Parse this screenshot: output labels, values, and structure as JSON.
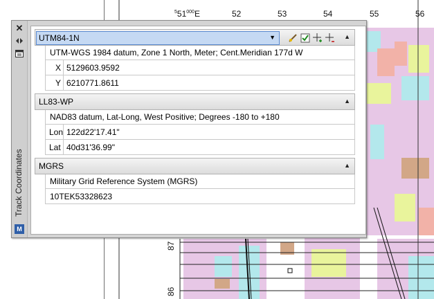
{
  "map": {
    "top_ticks": [
      "551000E",
      "52",
      "53",
      "54",
      "55",
      "56"
    ],
    "top_tick_first_sup": "51",
    "side_ticks": [
      "87",
      "86"
    ]
  },
  "palette": {
    "title": "Track Coordinates",
    "logo_text": "M"
  },
  "utm": {
    "selected": "UTM84-1N",
    "description": "UTM-WGS 1984 datum, Zone 1 North, Meter; Cent.Meridian 177d W",
    "rows": [
      {
        "key": "X",
        "value": "5129603.9592"
      },
      {
        "key": "Y",
        "value": "6210771.8611"
      }
    ]
  },
  "ll83": {
    "header": "LL83-WP",
    "description": "NAD83 datum, Lat-Long, West Positive; Degrees -180 to +180",
    "rows": [
      {
        "key": "Lon",
        "value": "122d22'17.41\""
      },
      {
        "key": "Lat",
        "value": "40d31'36.99\""
      }
    ]
  },
  "mgrs": {
    "header": "MGRS",
    "description": "Military Grid Reference System (MGRS)",
    "value": "10TEK53328623"
  }
}
